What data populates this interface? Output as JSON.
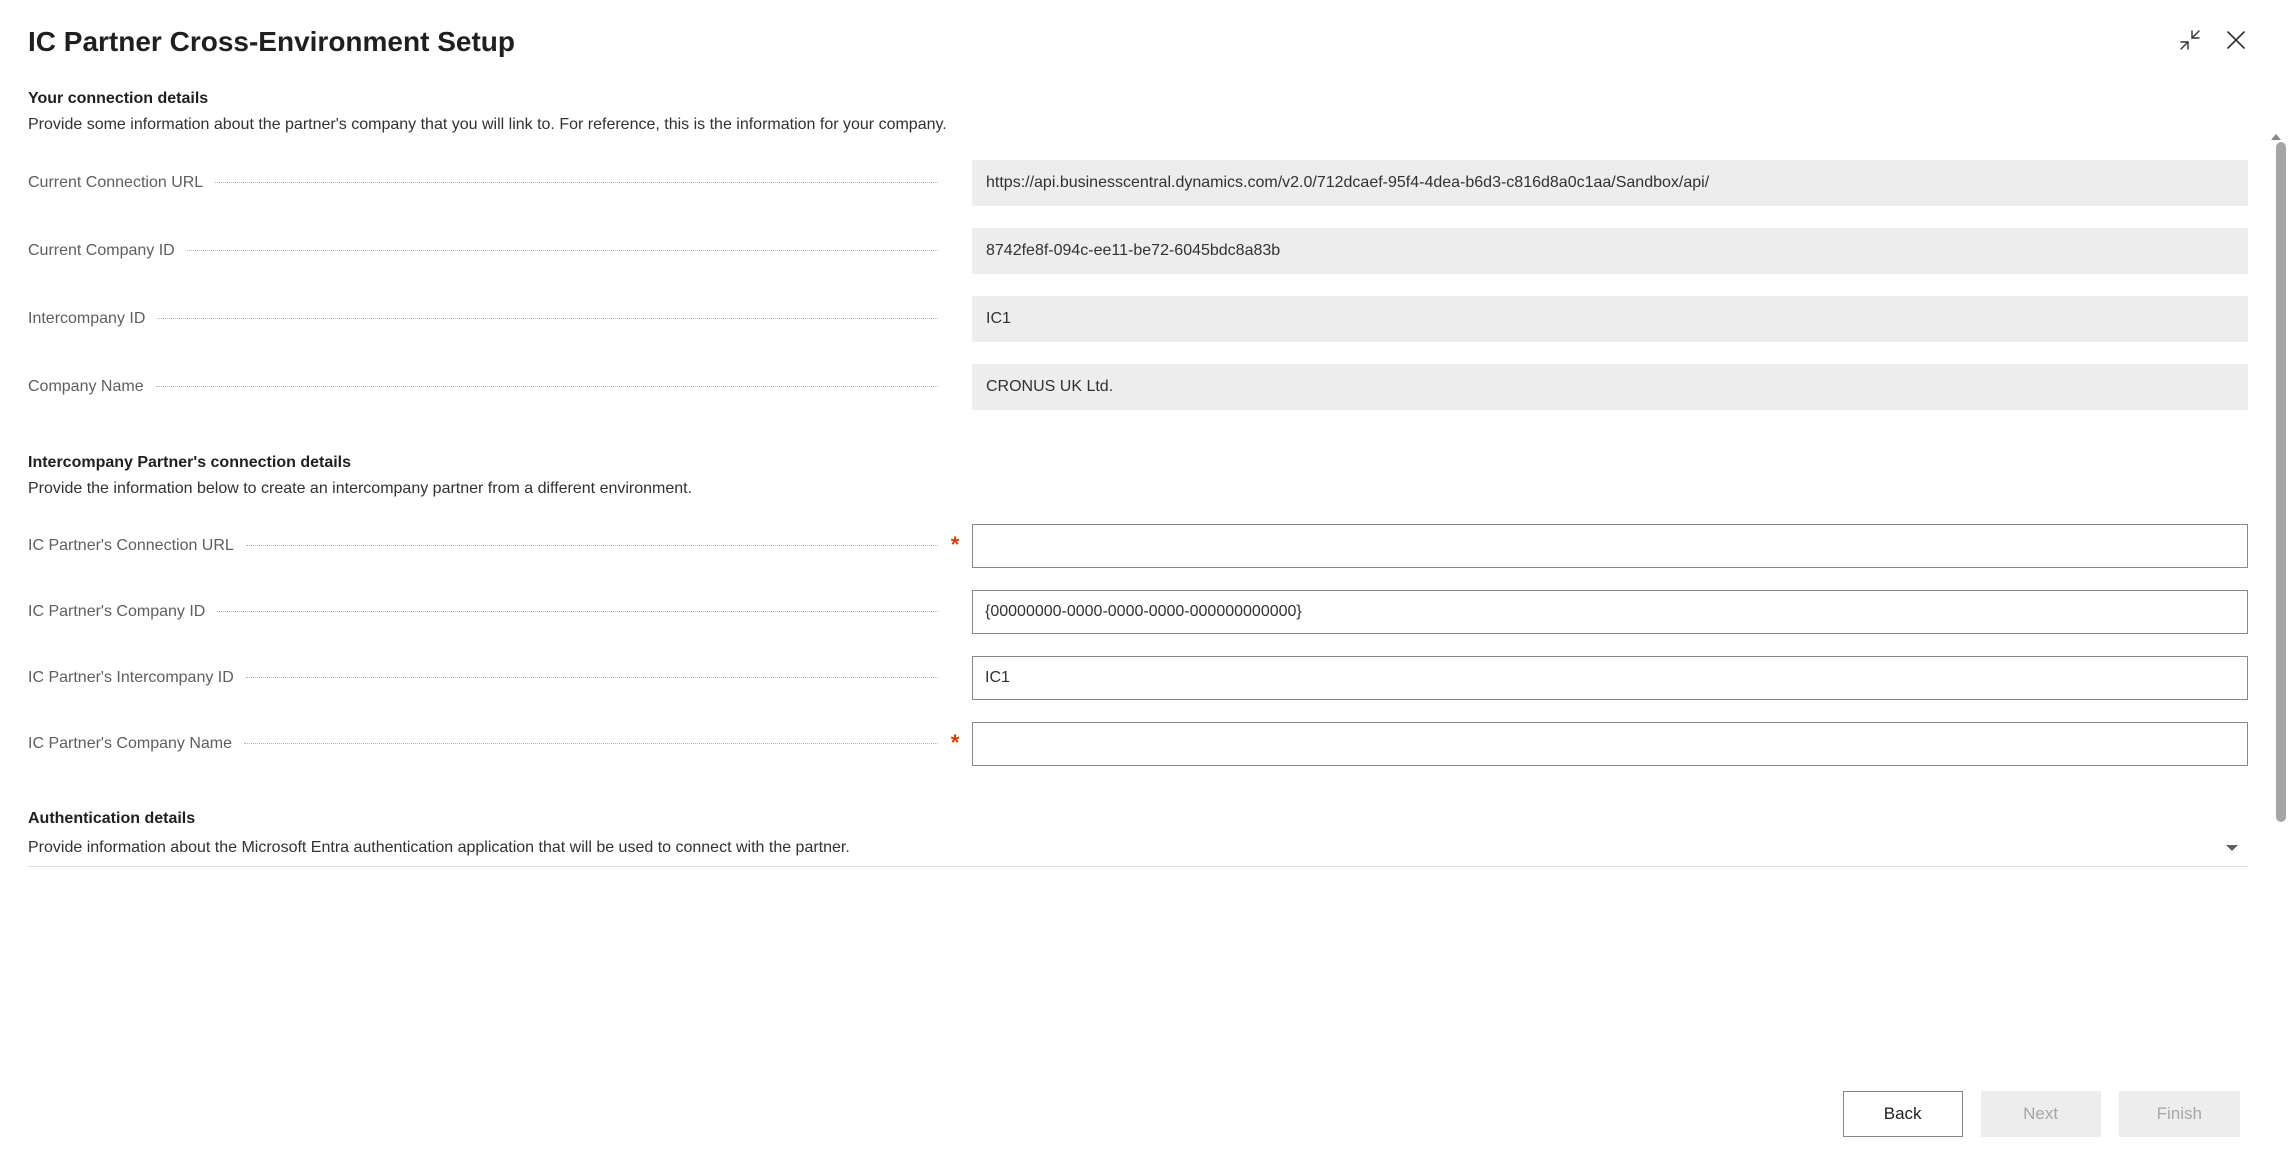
{
  "page_title": "IC Partner Cross-Environment Setup",
  "section1": {
    "title": "Your connection details",
    "desc": "Provide some information about the partner's company that you will link to. For reference, this is the information for your company.",
    "fields": {
      "current_connection_url_label": "Current Connection URL",
      "current_connection_url_value": "https://api.businesscentral.dynamics.com/v2.0/712dcaef-95f4-4dea-b6d3-c816d8a0c1aa/Sandbox/api/",
      "current_company_id_label": "Current Company ID",
      "current_company_id_value": "8742fe8f-094c-ee11-be72-6045bdc8a83b",
      "intercompany_id_label": "Intercompany ID",
      "intercompany_id_value": "IC1",
      "company_name_label": "Company Name",
      "company_name_value": "CRONUS UK Ltd."
    }
  },
  "section2": {
    "title": "Intercompany Partner's connection details",
    "desc": "Provide the information below to create an intercompany partner from a different environment.",
    "fields": {
      "partner_connection_url_label": "IC Partner's Connection URL",
      "partner_connection_url_value": "",
      "partner_company_id_label": "IC Partner's Company ID",
      "partner_company_id_value": "{00000000-0000-0000-0000-000000000000}",
      "partner_intercompany_id_label": "IC Partner's Intercompany ID",
      "partner_intercompany_id_value": "IC1",
      "partner_company_name_label": "IC Partner's Company Name",
      "partner_company_name_value": ""
    }
  },
  "section3": {
    "title": "Authentication details",
    "desc": "Provide information about the Microsoft Entra authentication application that will be used to connect with the partner."
  },
  "footer": {
    "back": "Back",
    "next": "Next",
    "finish": "Finish"
  }
}
